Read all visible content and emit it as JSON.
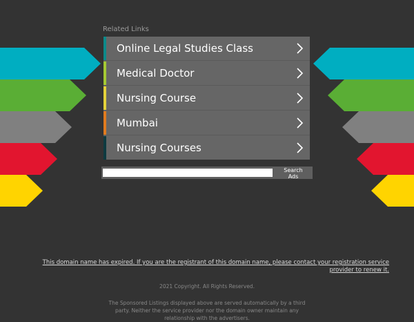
{
  "related": {
    "title": "Related Links",
    "items": [
      {
        "label": "Online Legal Studies Class",
        "accent": "#0c8a8a"
      },
      {
        "label": "Medical Doctor",
        "accent": "#a5c933"
      },
      {
        "label": "Nursing Course",
        "accent": "#e4d23a"
      },
      {
        "label": "Mumbai",
        "accent": "#e07b1f"
      },
      {
        "label": "Nursing Courses",
        "accent": "#0d3a40"
      }
    ]
  },
  "search": {
    "placeholder": "",
    "button_label": "Search Ads"
  },
  "footer": {
    "expired_notice": "This domain name has expired. If you are the registrant of this domain name, please contact your registration service provider to renew it.",
    "copyright": "2021 Copyright. All Rights Reserved.",
    "disclaimer": "The Sponsored Listings displayed above are served automatically by a third party. Neither the service provider nor the domain owner maintain any relationship with the advertisers."
  },
  "colors": {
    "background": "#333333",
    "cyan": "#00aec1",
    "green": "#5aae35",
    "gray": "#808080",
    "red": "#e2152f",
    "yellow": "#ffd400"
  }
}
